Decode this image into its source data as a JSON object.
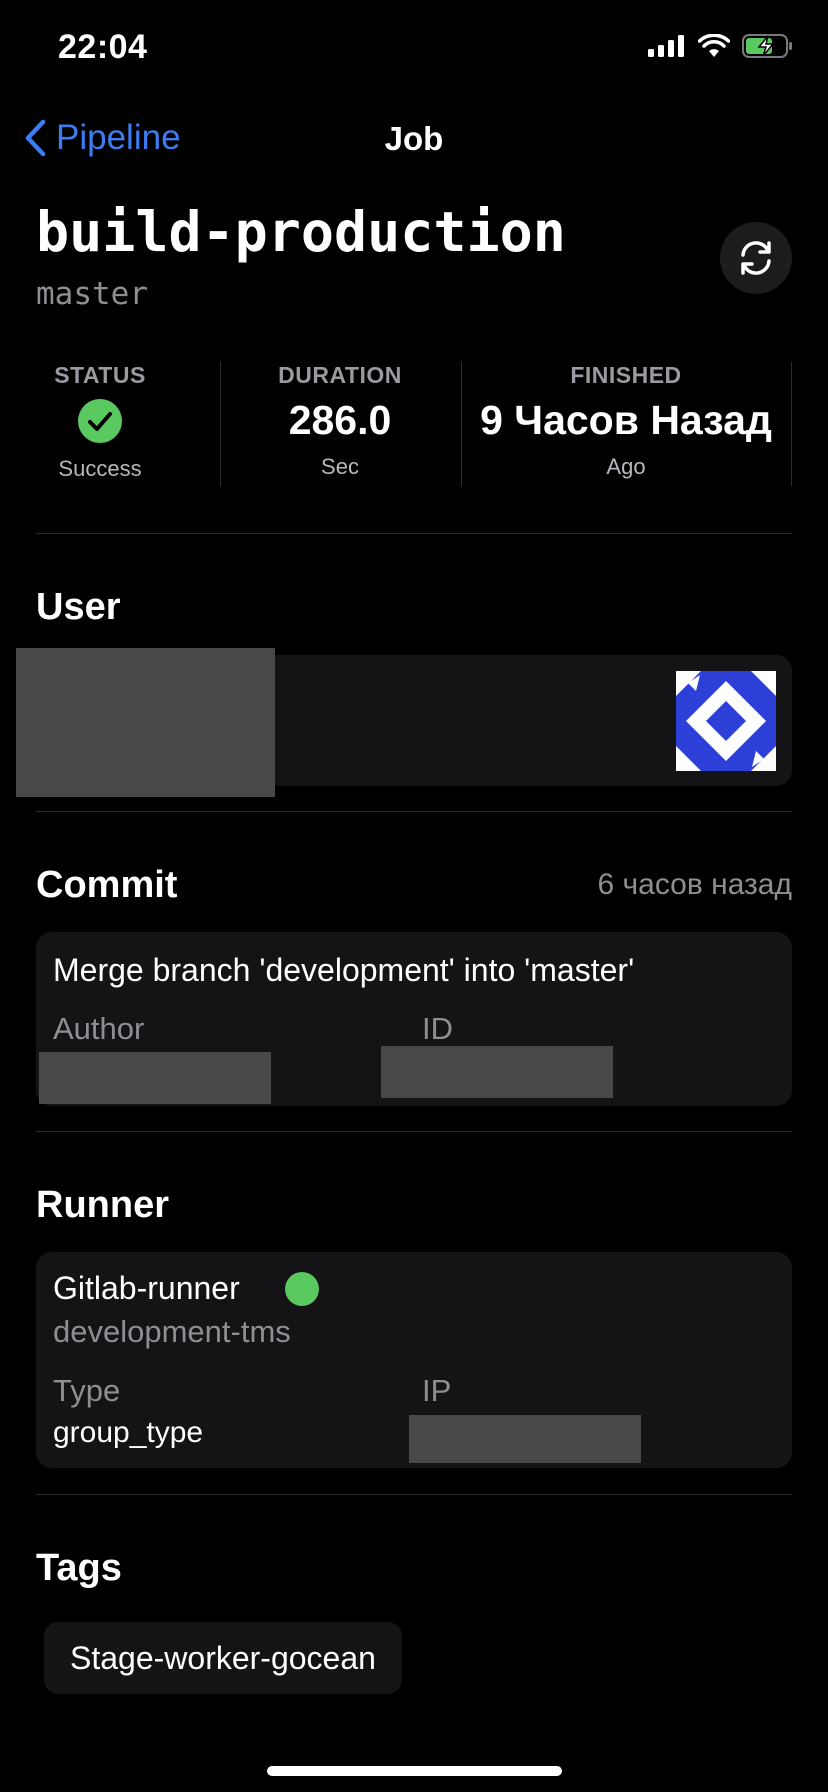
{
  "status_bar": {
    "time": "22:04"
  },
  "nav": {
    "back_label": "Pipeline",
    "title": "Job"
  },
  "job": {
    "name": "build-production",
    "branch": "master"
  },
  "stats": {
    "status": {
      "label": "STATUS",
      "value": "Success"
    },
    "duration": {
      "label": "DURATION",
      "value": "286.0",
      "unit": "Sec"
    },
    "finished": {
      "label": "FINISHED",
      "value": "9 Часов Назад",
      "sub": "Ago"
    }
  },
  "user": {
    "title": "User"
  },
  "commit": {
    "title": "Commit",
    "time_ago": "6 часов назад",
    "message": "Merge branch 'development' into 'master'",
    "author_label": "Author",
    "id_label": "ID"
  },
  "runner": {
    "title": "Runner",
    "name": "Gitlab-runner",
    "description": "development-tms",
    "type_label": "Type",
    "type_value": "group_type",
    "ip_label": "IP"
  },
  "tags": {
    "title": "Tags",
    "items": [
      "Stage-worker-gocean"
    ]
  },
  "colors": {
    "accent": "#3d7df2",
    "success": "#5ac95f",
    "avatar": "#2c3fd6"
  }
}
